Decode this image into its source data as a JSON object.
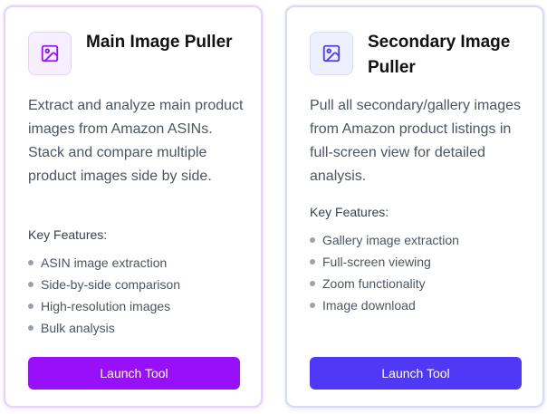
{
  "cards": [
    {
      "icon": "image-icon",
      "accent": "#9810fa",
      "title": "Main Image Puller",
      "description": "Extract and analyze main product images from Amazon ASINs. Stack and compare multiple product images side by side.",
      "features_label": "Key Features:",
      "features": [
        "ASIN image extraction",
        "Side-by-side comparison",
        "High-resolution images",
        "Bulk analysis"
      ],
      "button_label": "Launch Tool"
    },
    {
      "icon": "image-icon",
      "accent": "#4f39f6",
      "title": "Secondary Image Puller",
      "description": "Pull all secondary/gallery images from Amazon product listings in full-screen view for detailed analysis.",
      "features_label": "Key Features:",
      "features": [
        "Gallery image extraction",
        "Full-screen viewing",
        "Zoom functionality",
        "Image download"
      ],
      "button_label": "Launch Tool"
    }
  ]
}
